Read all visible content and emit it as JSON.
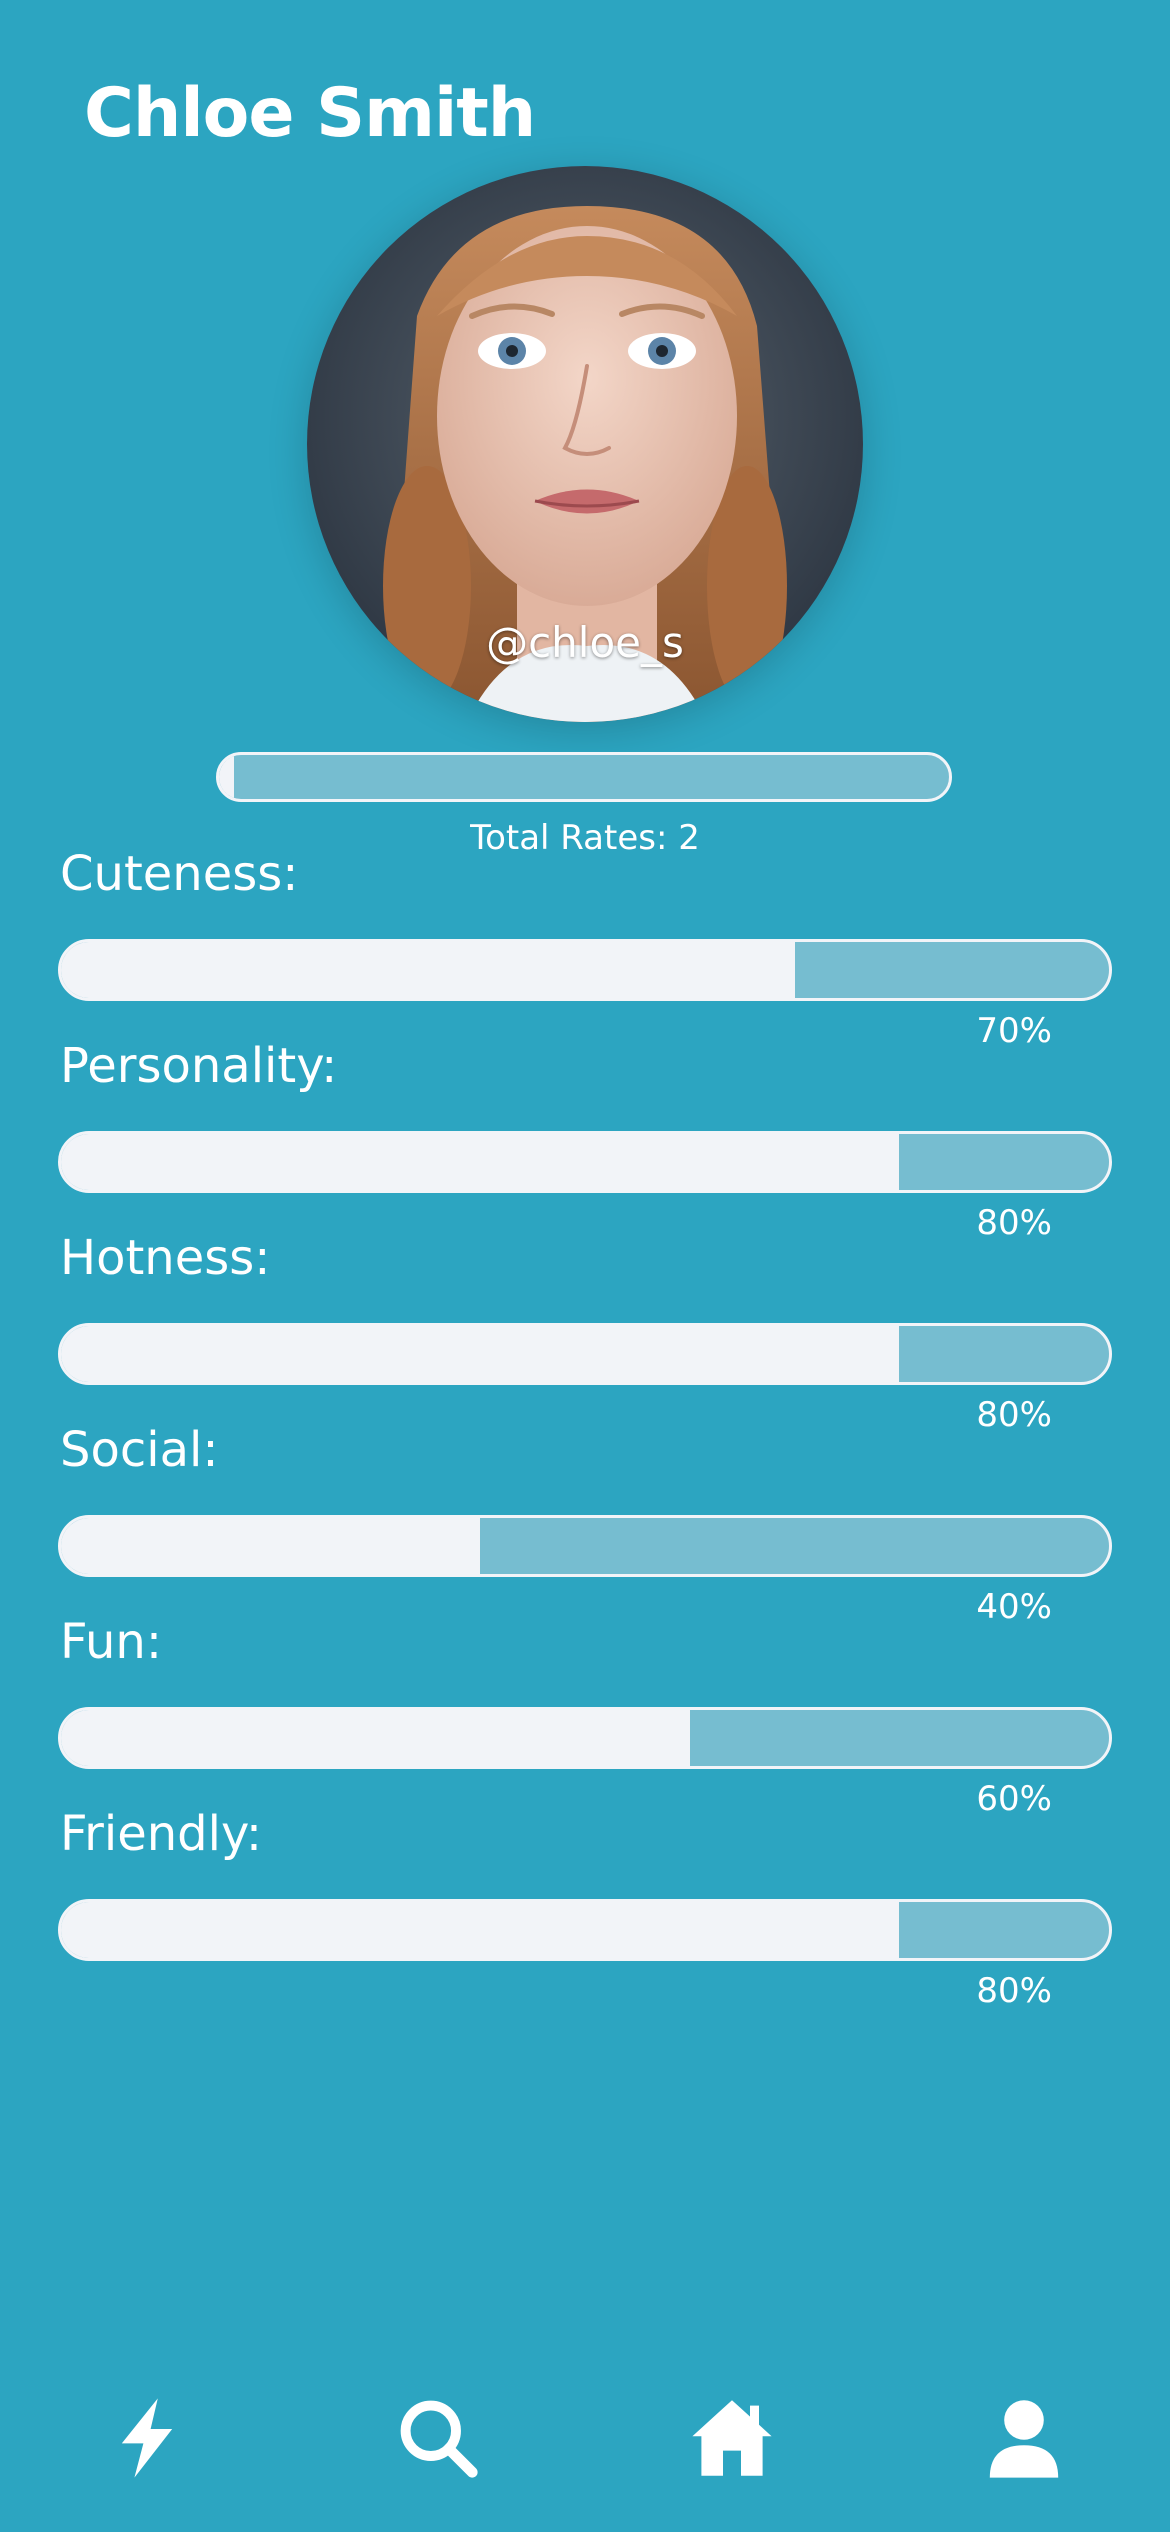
{
  "profile": {
    "name": "Chloe Smith",
    "handle": "@chloe_s"
  },
  "total_rates": {
    "label": "Total Rates: 2",
    "fill_fraction": 0.02
  },
  "stats": [
    {
      "label": "Cuteness:",
      "percent_label": "70%",
      "value": 0.7
    },
    {
      "label": "Personality:",
      "percent_label": "80%",
      "value": 0.8
    },
    {
      "label": "Hotness:",
      "percent_label": "80%",
      "value": 0.8
    },
    {
      "label": "Social:",
      "percent_label": "40%",
      "value": 0.4
    },
    {
      "label": "Fun:",
      "percent_label": "60%",
      "value": 0.6
    },
    {
      "label": "Friendly:",
      "percent_label": "80%",
      "value": 0.8
    }
  ],
  "nav": [
    {
      "name": "lightning-icon"
    },
    {
      "name": "search-icon"
    },
    {
      "name": "home-icon"
    },
    {
      "name": "profile-icon"
    }
  ],
  "colors": {
    "background": "#2ca5c1",
    "bar_fill": "#f2f4f8",
    "bar_track": "#76bdd0",
    "text": "#ffffff"
  }
}
